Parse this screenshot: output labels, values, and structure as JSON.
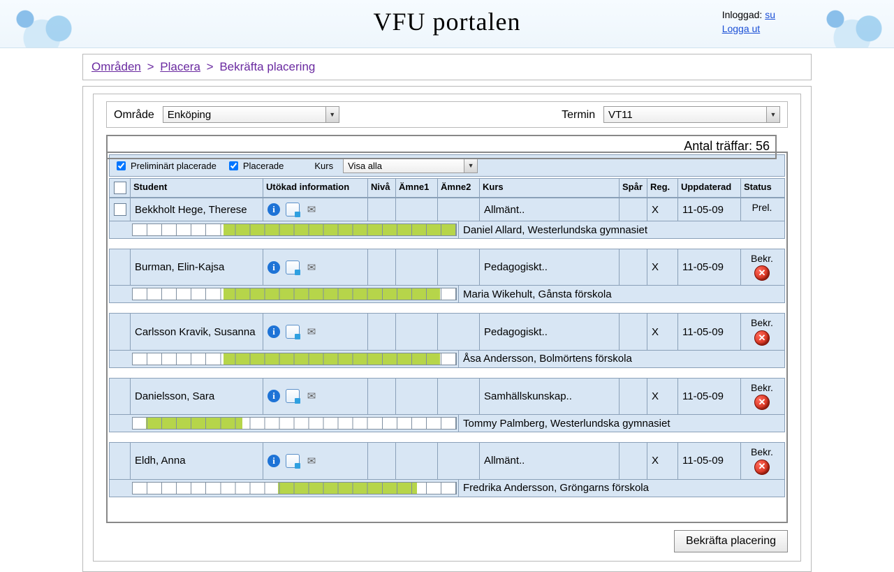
{
  "header": {
    "title": "VFU portalen",
    "logged_in_label": "Inloggad:",
    "user": "su",
    "logout": "Logga ut"
  },
  "breadcrumb": {
    "a": "Områden",
    "b": "Placera",
    "c": "Bekräfta placering"
  },
  "filters": {
    "area_label": "Område",
    "area_value": "Enköping",
    "term_label": "Termin",
    "term_value": "VT11",
    "hits_label": "Antal träffar:",
    "hits_value": "56",
    "prelim_label": "Preliminärt placerade",
    "placed_label": "Placerade",
    "kurs_label": "Kurs",
    "kurs_value": "Visa alla"
  },
  "columns": {
    "student": "Student",
    "ext": "Utökad information",
    "niva": "Nivå",
    "amne1": "Ämne1",
    "amne2": "Ämne2",
    "kurs": "Kurs",
    "spar": "Spår",
    "reg": "Reg.",
    "upd": "Uppdaterad",
    "status": "Status"
  },
  "rows": [
    {
      "checkbox": true,
      "student": "Bekkholt Hege, Therese",
      "kurs": "Allmänt..",
      "reg": "X",
      "upd": "11-05-09",
      "status": "Prel.",
      "close_icon": false,
      "bar": {
        "left_pct": 28,
        "right_pct": 100
      },
      "desc": "Daniel Allard, Westerlundska gymnasiet"
    },
    {
      "student": "Burman, Elin-Kajsa",
      "kurs": "Pedagogiskt..",
      "reg": "X",
      "upd": "11-05-09",
      "status": "Bekr.",
      "close_icon": true,
      "bar": {
        "left_pct": 28,
        "right_pct": 95
      },
      "desc": "Maria Wikehult, Gånsta förskola"
    },
    {
      "student": "Carlsson Kravik, Susanna",
      "kurs": "Pedagogiskt..",
      "reg": "X",
      "upd": "11-05-09",
      "status": "Bekr.",
      "close_icon": true,
      "bar": {
        "left_pct": 28,
        "right_pct": 95
      },
      "desc": "Åsa Andersson, Bolmörtens förskola"
    },
    {
      "student": "Danielsson, Sara",
      "kurs": "Samhällskunskap..",
      "reg": "X",
      "upd": "11-05-09",
      "status": "Bekr.",
      "close_icon": true,
      "bar": {
        "left_pct": 4,
        "right_pct": 34
      },
      "desc": "Tommy Palmberg, Westerlundska gymnasiet"
    },
    {
      "student": "Eldh, Anna",
      "kurs": "Allmänt..",
      "reg": "X",
      "upd": "11-05-09",
      "status": "Bekr.",
      "close_icon": true,
      "bar": {
        "left_pct": 45,
        "right_pct": 88
      },
      "desc": "Fredrika Andersson, Gröngarns förskola"
    }
  ],
  "confirm_label": "Bekräfta placering",
  "icons": {
    "info": "i",
    "doc": "≣",
    "mail": "✉",
    "close": "✕",
    "caret": "▼"
  }
}
